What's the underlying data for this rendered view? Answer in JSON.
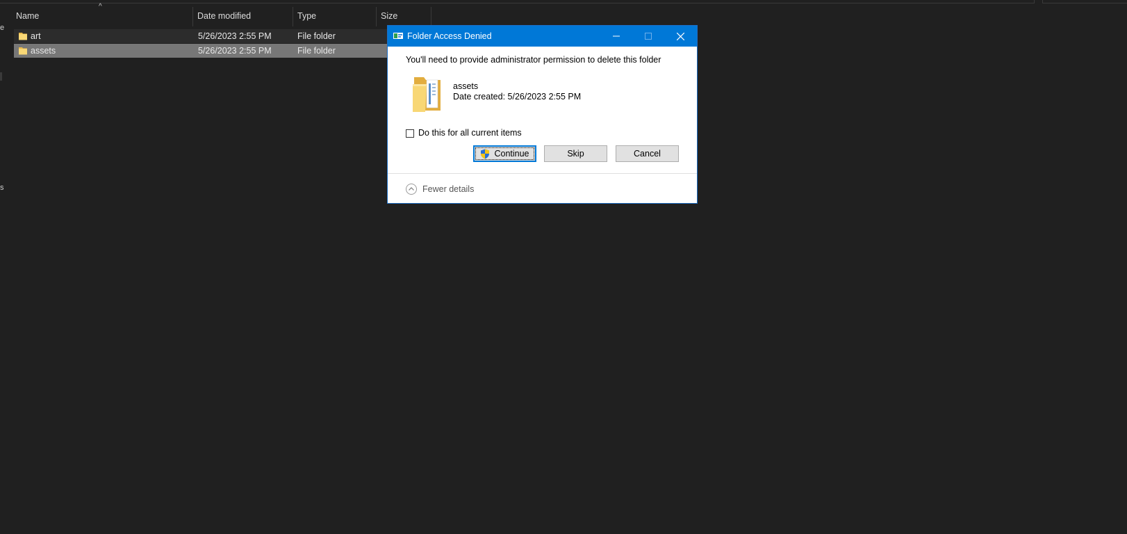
{
  "explorer": {
    "columns": {
      "name": "Name",
      "date_modified": "Date modified",
      "type": "Type",
      "size": "Size"
    },
    "rows": [
      {
        "name": "art",
        "date": "5/26/2023 2:55 PM",
        "type": "File folder"
      },
      {
        "name": "assets",
        "date": "5/26/2023 2:55 PM",
        "type": "File folder"
      }
    ],
    "left_edge_glyphs": [
      "e",
      "s"
    ]
  },
  "dialog": {
    "title": "Folder Access Denied",
    "message": "You'll need to provide administrator permission to delete this folder",
    "item_name": "assets",
    "item_date": "Date created: 5/26/2023 2:55 PM",
    "checkbox_label": "Do this for all current items",
    "checkbox_checked": false,
    "buttons": {
      "continue": "Continue",
      "skip": "Skip",
      "cancel": "Cancel"
    },
    "fewer_details": "Fewer details"
  },
  "colors": {
    "titlebar": "#0078d7",
    "explorer_bg": "#202020",
    "selected_row": "#777777",
    "folder_yellow": "#f8d775"
  }
}
